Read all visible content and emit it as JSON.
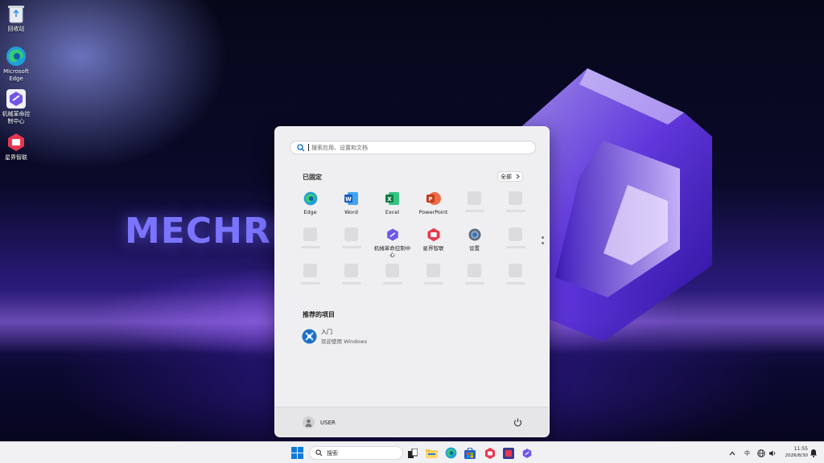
{
  "desktop": {
    "icons": [
      {
        "label": "回收站",
        "icon": "recycle-bin-icon"
      },
      {
        "label": "Microsoft Edge",
        "icon": "edge-icon"
      },
      {
        "label": "机械革命控制中心",
        "icon": "mechrevo-control-center-icon"
      },
      {
        "label": "星界智联",
        "icon": "xingjie-zhilian-icon"
      }
    ],
    "wallpaper_text": "MECHRE"
  },
  "start_menu": {
    "search_placeholder": "搜索应用、设置和文档",
    "pinned_title": "已固定",
    "all_label": "全部",
    "pinned": [
      {
        "label": "Edge",
        "icon": "edge-icon"
      },
      {
        "label": "Word",
        "icon": "word-icon"
      },
      {
        "label": "Excel",
        "icon": "excel-icon"
      },
      {
        "label": "PowerPoint",
        "icon": "powerpoint-icon"
      },
      {
        "label": "机械革命控制中心",
        "icon": "mechrevo-control-center-icon"
      },
      {
        "label": "星界智联",
        "icon": "xingjie-zhilian-icon"
      },
      {
        "label": "设置",
        "icon": "settings-gear-icon"
      }
    ],
    "recommended_title": "推荐的项目",
    "recommended": [
      {
        "title": "入门",
        "subtitle": "欢迎使用 Windows",
        "icon": "get-started-icon"
      }
    ],
    "user_name": "USER"
  },
  "taskbar": {
    "search_label": "搜索",
    "ime_label": "中",
    "time": "11:55",
    "date": "2026/8/30"
  },
  "colors": {
    "accent": "#0067c0",
    "start_bg": "#efeff1",
    "taskbar_bg": "#f1f1f4"
  }
}
